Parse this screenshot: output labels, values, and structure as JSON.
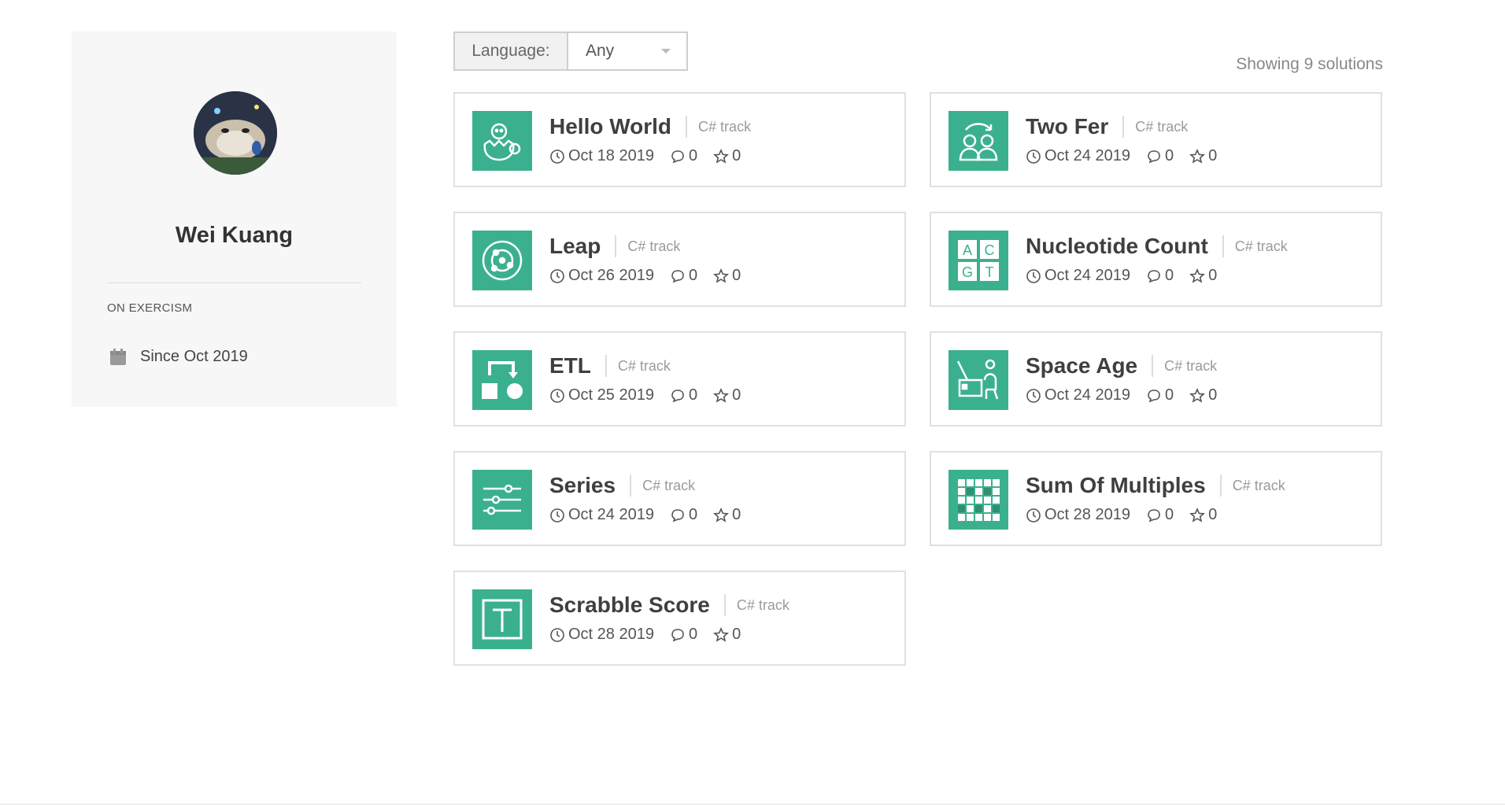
{
  "profile": {
    "name": "Wei Kuang",
    "section_label": "ON EXERCISM",
    "since": "Since Oct 2019"
  },
  "filter": {
    "language_label": "Language:",
    "language_value": "Any"
  },
  "summary": {
    "showing": "Showing 9 solutions"
  },
  "solutions": [
    {
      "title": "Hello World",
      "track": "C# track",
      "date": "Oct 18 2019",
      "comments": "0",
      "stars": "0",
      "icon": "hatching-chick-icon"
    },
    {
      "title": "Two Fer",
      "track": "C# track",
      "date": "Oct 24 2019",
      "comments": "0",
      "stars": "0",
      "icon": "two-people-icon"
    },
    {
      "title": "Leap",
      "track": "C# track",
      "date": "Oct 26 2019",
      "comments": "0",
      "stars": "0",
      "icon": "orbit-icon"
    },
    {
      "title": "Nucleotide Count",
      "track": "C# track",
      "date": "Oct 24 2019",
      "comments": "0",
      "stars": "0",
      "icon": "acgt-grid-icon"
    },
    {
      "title": "ETL",
      "track": "C# track",
      "date": "Oct 25 2019",
      "comments": "0",
      "stars": "0",
      "icon": "transform-shapes-icon"
    },
    {
      "title": "Space Age",
      "track": "C# track",
      "date": "Oct 24 2019",
      "comments": "0",
      "stars": "0",
      "icon": "astronaut-computer-icon"
    },
    {
      "title": "Series",
      "track": "C# track",
      "date": "Oct 24 2019",
      "comments": "0",
      "stars": "0",
      "icon": "sliders-icon"
    },
    {
      "title": "Sum Of Multiples",
      "track": "C# track",
      "date": "Oct 28 2019",
      "comments": "0",
      "stars": "0",
      "icon": "checker-grid-icon"
    },
    {
      "title": "Scrabble Score",
      "track": "C# track",
      "date": "Oct 28 2019",
      "comments": "0",
      "stars": "0",
      "icon": "letter-tile-icon"
    }
  ],
  "colors": {
    "accent": "#3bb08f",
    "sidebar_bg": "#f7f7f7"
  }
}
